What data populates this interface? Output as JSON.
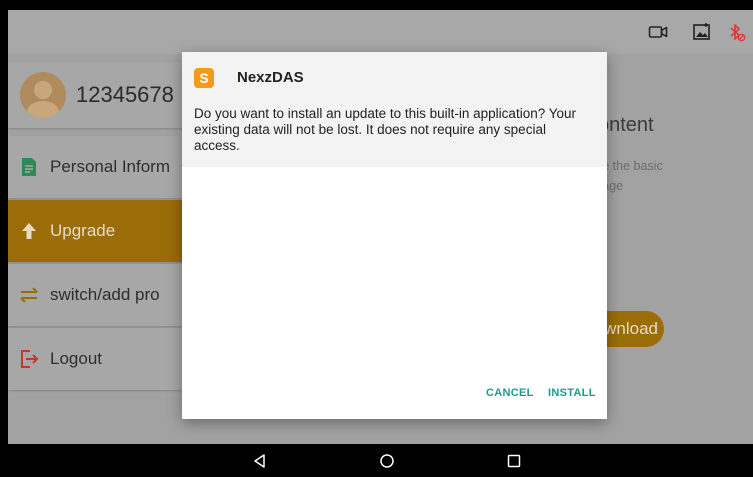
{
  "statusbar": {
    "icons": [
      "video-camera-icon",
      "image-icon",
      "bluetooth-disabled-icon"
    ],
    "bluetooth_color": "#e53935"
  },
  "sidebar": {
    "profile_name": "12345678",
    "items": [
      {
        "label": "Personal Inform",
        "icon": "document-icon"
      },
      {
        "label": "Upgrade",
        "icon": "arrow-up-icon",
        "selected": true
      },
      {
        "label": "switch/add pro",
        "icon": "swap-arrows-icon"
      },
      {
        "label": "Logout",
        "icon": "logout-icon"
      }
    ]
  },
  "main": {
    "title_fragment": "ontent",
    "desc_line1": "ze the basic",
    "desc_line2": "kage",
    "button_fragment": "wnload"
  },
  "dialog": {
    "app_name": "NexzDAS",
    "app_icon_letter": "S",
    "message": "Do you want to install an update to this built-in application? Your existing data will not be lost. It does not require any special access.",
    "cancel_label": "CANCEL",
    "install_label": "INSTALL"
  },
  "navbar": {
    "icons": [
      "back-icon",
      "home-icon",
      "recents-icon"
    ]
  },
  "colors": {
    "accent": "#9a6d08",
    "dialog_button": "#1d9a8a",
    "app_icon": "#f39b1c"
  }
}
